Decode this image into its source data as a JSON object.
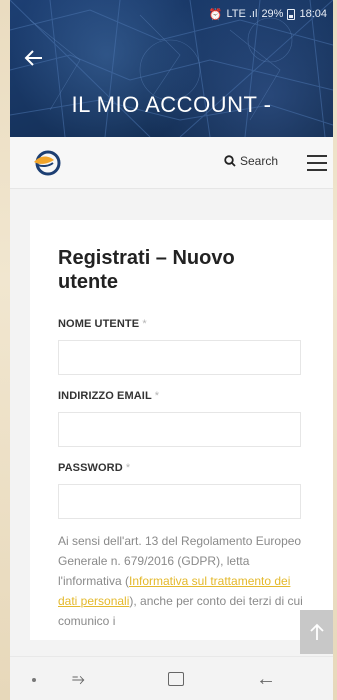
{
  "status_bar": {
    "signal_text": "LTE .ıl",
    "battery_percent": "29%",
    "time": "18:04"
  },
  "header": {
    "title": "IL MIO ACCOUNT -"
  },
  "navbar": {
    "search_label": "Search"
  },
  "form": {
    "title": "Registrati – Nuovo utente",
    "fields": [
      {
        "label": "NOME UTENTE",
        "required_mark": "*",
        "value": ""
      },
      {
        "label": "INDIRIZZO EMAIL",
        "required_mark": "*",
        "value": ""
      },
      {
        "label": "PASSWORD",
        "required_mark": "*",
        "value": ""
      }
    ],
    "consent_text_before": "Ai sensi dell'art. 13 del Regolamento Europeo Generale n. 679/2016 (GDPR), letta l'informativa (",
    "consent_link": "Informativa sul trattamento dei dati personali",
    "consent_text_after": "), anche per conto dei terzi di cui comunico i"
  },
  "colors": {
    "header_bg": "#173561",
    "link": "#e4b92c",
    "logo_orange": "#f2a52a",
    "logo_navy": "#1d3f73"
  },
  "icons": {
    "back": "arrow-left-icon",
    "search": "search-icon",
    "menu": "hamburger-menu-icon",
    "to_top": "arrow-up-icon"
  }
}
